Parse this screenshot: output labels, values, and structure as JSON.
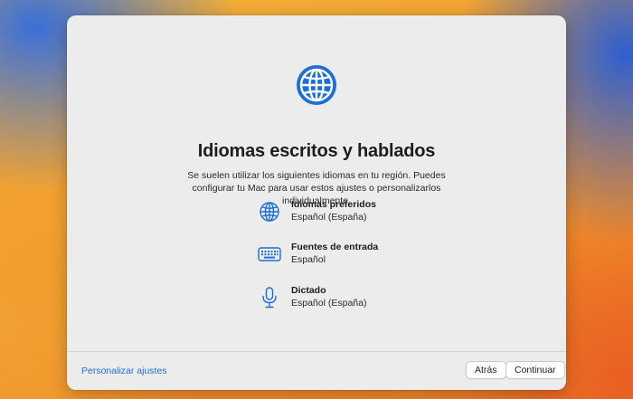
{
  "setup": {
    "title": "Idiomas escritos y hablados",
    "description": "Se suelen utilizar los siguientes idiomas en tu región. Puedes configurar tu Mac para usar estos ajustes o personalizarlos individualmente.",
    "items": [
      {
        "name": "Idiomas preferidos",
        "value": "Español (España)",
        "icon": "globe-icon"
      },
      {
        "name": "Fuentes de entrada",
        "value": "Español",
        "icon": "keyboard-icon"
      },
      {
        "name": "Dictado",
        "value": "Español (España)",
        "icon": "microphone-icon"
      }
    ],
    "hero_icon": "globe-icon"
  },
  "footer": {
    "customize_label": "Personalizar ajustes",
    "back_label": "Atrás",
    "continue_label": "Continuar"
  },
  "colors": {
    "accent": "#1c6fd8",
    "window_bg": "#ececec"
  }
}
